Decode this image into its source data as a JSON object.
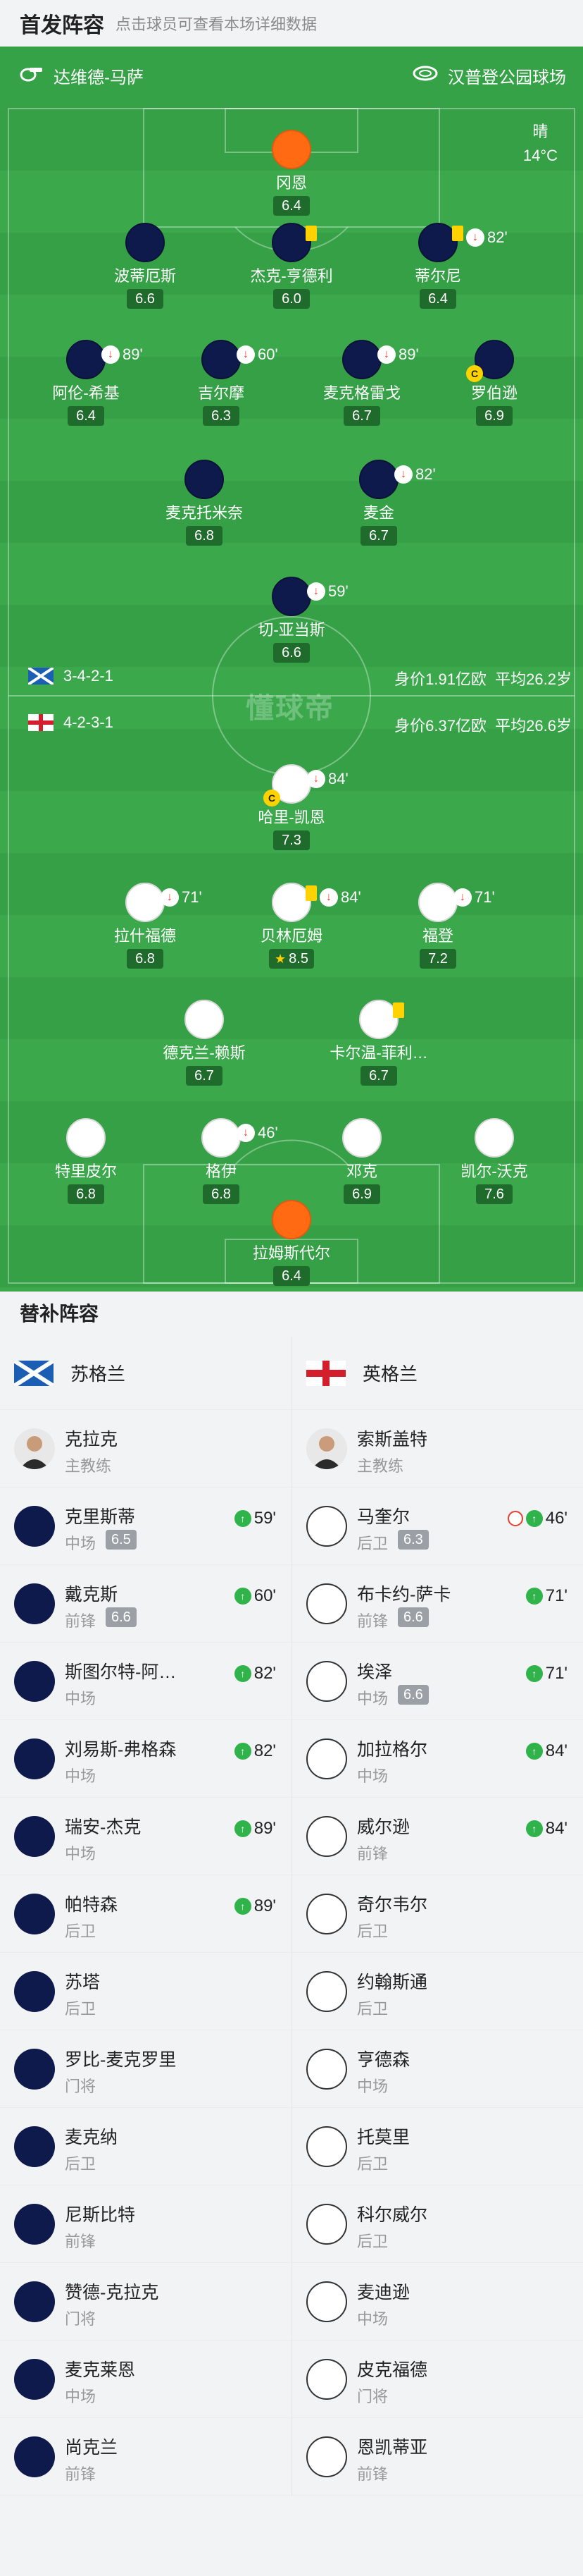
{
  "header": {
    "title": "首发阵容",
    "hint": "点击球员可查看本场详细数据"
  },
  "match": {
    "referee": "达维德-马萨",
    "stadium": "汉普登公园球场",
    "weather": "晴",
    "temp": "14°C",
    "watermark": "懂球帝"
  },
  "scotland": {
    "formation": "3-4-2-1",
    "value": "身价1.91亿欧",
    "age": "平均26.2岁"
  },
  "england": {
    "formation": "4-2-3-1",
    "value": "身价6.37亿欧",
    "age": "平均26.6岁"
  },
  "home_players": [
    {
      "name": "冈恩",
      "rating": "6.4",
      "kit": "orange"
    },
    {
      "name": "波蒂厄斯",
      "rating": "6.6",
      "kit": "navy"
    },
    {
      "name": "杰克-亨德利",
      "rating": "6.0",
      "kit": "navy",
      "yellow": true
    },
    {
      "name": "蒂尔尼",
      "rating": "6.4",
      "kit": "navy",
      "yellow": true,
      "off": "82'"
    },
    {
      "name": "阿伦-希基",
      "rating": "6.4",
      "kit": "navy",
      "off": "89'"
    },
    {
      "name": "吉尔摩",
      "rating": "6.3",
      "kit": "navy",
      "off": "60'"
    },
    {
      "name": "麦克格雷戈",
      "rating": "6.7",
      "kit": "navy",
      "off": "89'"
    },
    {
      "name": "罗伯逊",
      "rating": "6.9",
      "kit": "navy",
      "captain": "C"
    },
    {
      "name": "麦克托米奈",
      "rating": "6.8",
      "kit": "navy"
    },
    {
      "name": "麦金",
      "rating": "6.7",
      "kit": "navy",
      "off": "82'"
    },
    {
      "name": "切-亚当斯",
      "rating": "6.6",
      "kit": "navy",
      "off": "59'"
    }
  ],
  "away_players": [
    {
      "name": "哈里-凯恩",
      "rating": "7.3",
      "kit": "white",
      "off": "84'",
      "captain": "C"
    },
    {
      "name": "拉什福德",
      "rating": "6.8",
      "kit": "white",
      "off": "71'"
    },
    {
      "name": "贝林厄姆",
      "rating": "8.5",
      "kit": "white",
      "off": "84'",
      "yellow": true,
      "star": "★"
    },
    {
      "name": "福登",
      "rating": "7.2",
      "kit": "white",
      "off": "71'"
    },
    {
      "name": "德克兰-赖斯",
      "rating": "6.7",
      "kit": "white"
    },
    {
      "name": "卡尔温-菲利…",
      "rating": "6.7",
      "kit": "white",
      "yellow": true
    },
    {
      "name": "特里皮尔",
      "rating": "6.8",
      "kit": "white"
    },
    {
      "name": "格伊",
      "rating": "6.8",
      "kit": "white",
      "off": "46'"
    },
    {
      "name": "邓克",
      "rating": "6.9",
      "kit": "white"
    },
    {
      "name": "凯尔-沃克",
      "rating": "7.6",
      "kit": "white"
    },
    {
      "name": "拉姆斯代尔",
      "rating": "6.4",
      "kit": "orange"
    }
  ],
  "subs": {
    "title": "替补阵容",
    "home_team": "苏格兰",
    "away_team": "英格兰",
    "home": [
      {
        "name": "克拉克",
        "pos": "主教练",
        "coach": true
      },
      {
        "name": "克里斯蒂",
        "pos": "中场",
        "rating": "6.5",
        "in": "59'"
      },
      {
        "name": "戴克斯",
        "pos": "前锋",
        "rating": "6.6",
        "in": "60'"
      },
      {
        "name": "斯图尔特-阿…",
        "pos": "中场",
        "in": "82'"
      },
      {
        "name": "刘易斯-弗格森",
        "pos": "中场",
        "in": "82'"
      },
      {
        "name": "瑞安-杰克",
        "pos": "中场",
        "in": "89'"
      },
      {
        "name": "帕特森",
        "pos": "后卫",
        "in": "89'"
      },
      {
        "name": "苏塔",
        "pos": "后卫"
      },
      {
        "name": "罗比-麦克罗里",
        "pos": "门将"
      },
      {
        "name": "麦克纳",
        "pos": "后卫"
      },
      {
        "name": "尼斯比特",
        "pos": "前锋"
      },
      {
        "name": "赞德-克拉克",
        "pos": "门将"
      },
      {
        "name": "麦克莱恩",
        "pos": "中场"
      },
      {
        "name": "尚克兰",
        "pos": "前锋"
      }
    ],
    "away": [
      {
        "name": "索斯盖特",
        "pos": "主教练",
        "coach": true
      },
      {
        "name": "马奎尔",
        "pos": "后卫",
        "rating": "6.3",
        "in": "46'",
        "goal": true
      },
      {
        "name": "布卡约-萨卡",
        "pos": "前锋",
        "rating": "6.6",
        "in": "71'"
      },
      {
        "name": "埃泽",
        "pos": "中场",
        "rating": "6.6",
        "in": "71'"
      },
      {
        "name": "加拉格尔",
        "pos": "中场",
        "in": "84'"
      },
      {
        "name": "威尔逊",
        "pos": "前锋",
        "in": "84'"
      },
      {
        "name": "奇尔韦尔",
        "pos": "后卫"
      },
      {
        "name": "约翰斯通",
        "pos": "后卫"
      },
      {
        "name": "亨德森",
        "pos": "中场"
      },
      {
        "name": "托莫里",
        "pos": "后卫"
      },
      {
        "name": "科尔威尔",
        "pos": "后卫"
      },
      {
        "name": "麦迪逊",
        "pos": "中场"
      },
      {
        "name": "皮克福德",
        "pos": "门将"
      },
      {
        "name": "恩凯蒂亚",
        "pos": "前锋"
      }
    ]
  }
}
